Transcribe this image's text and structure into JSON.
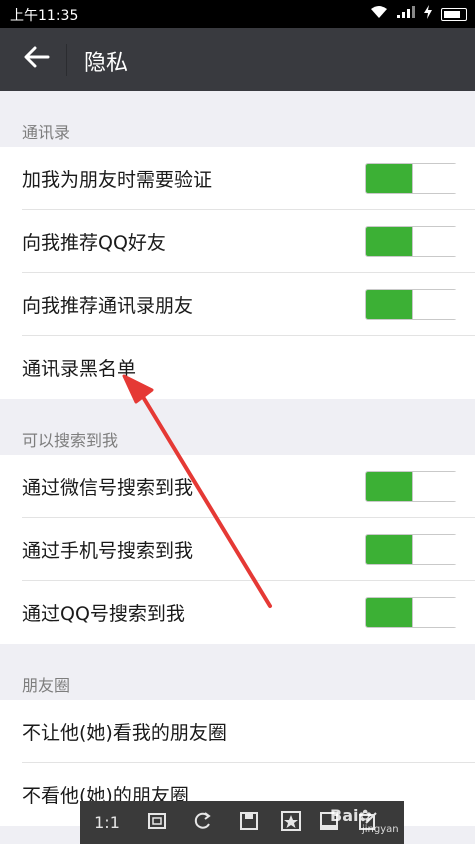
{
  "status_bar": {
    "time": "上午11:35"
  },
  "header": {
    "back_icon": "arrow-left-icon",
    "title": "隐私"
  },
  "sections": [
    {
      "header": "通讯录",
      "rows": [
        {
          "label": "加我为朋友时需要验证",
          "toggle": true
        },
        {
          "label": "向我推荐QQ好友",
          "toggle": true
        },
        {
          "label": "向我推荐通讯录朋友",
          "toggle": true
        },
        {
          "label": "通讯录黑名单",
          "toggle": null
        }
      ]
    },
    {
      "header": "可以搜索到我",
      "rows": [
        {
          "label": "通过微信号搜索到我",
          "toggle": true
        },
        {
          "label": "通过手机号搜索到我",
          "toggle": true
        },
        {
          "label": "通过QQ号搜索到我",
          "toggle": true
        }
      ]
    },
    {
      "header": "朋友圈",
      "rows": [
        {
          "label": "不让他(她)看我的朋友圈",
          "toggle": null
        },
        {
          "label": "不看他(她)的朋友圈",
          "toggle": null
        }
      ]
    }
  ],
  "toolbar": {
    "zoom_label": "1:1",
    "icons": [
      "fit-screen-icon",
      "rotate-icon",
      "save-icon",
      "favorite-icon",
      "window-icon",
      "edit-icon"
    ]
  },
  "watermark": {
    "brand": "Bai",
    "sub": "jingyan"
  },
  "colors": {
    "nav_bg": "#393a3f",
    "toggle_on": "#3cb035",
    "annotation_arrow": "#e53935"
  }
}
